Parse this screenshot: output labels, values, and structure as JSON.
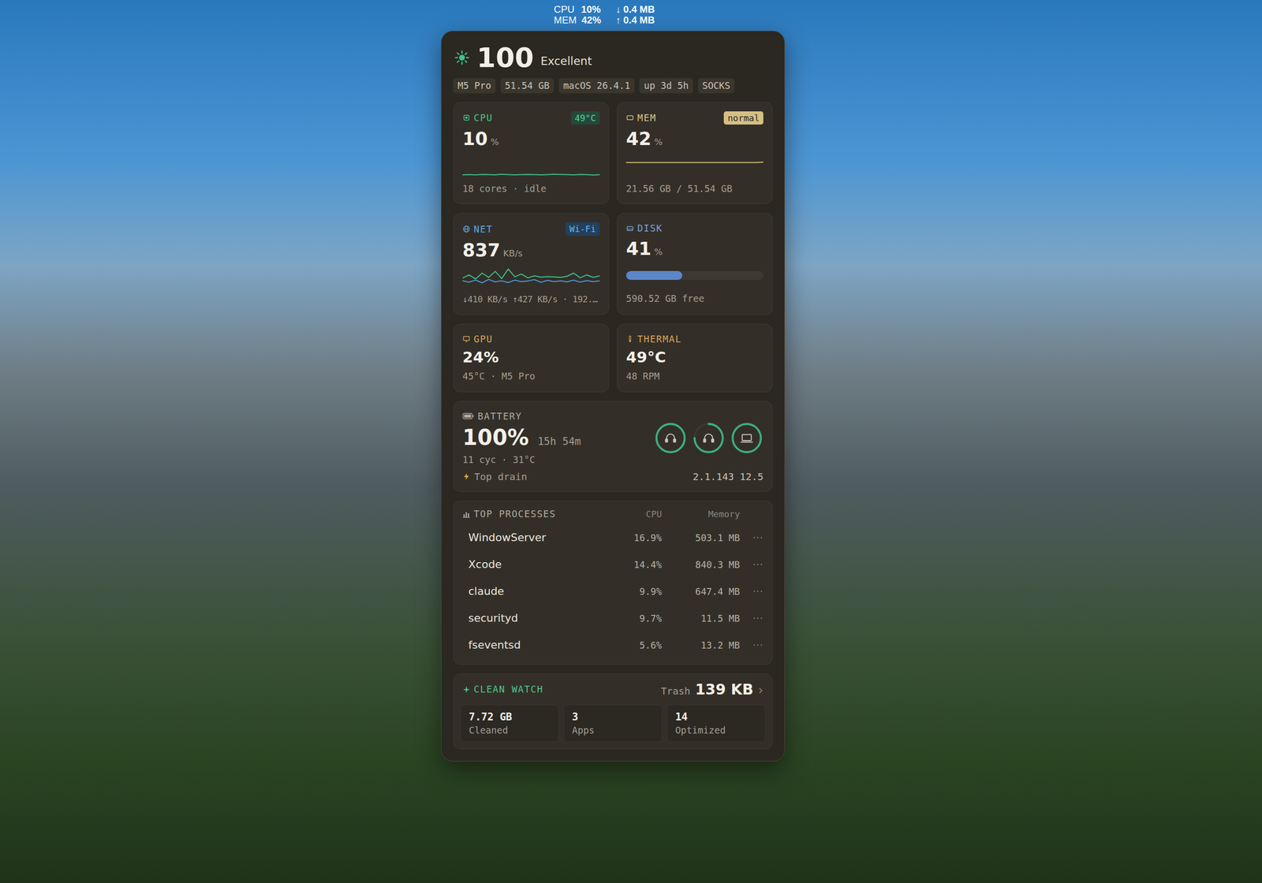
{
  "menubar": {
    "cpu_label": "CPU",
    "cpu_value": "10%",
    "mem_label": "MEM",
    "mem_value": "42%",
    "down": "↓ 0.4 MB",
    "up": "↑ 0.4 MB"
  },
  "health": {
    "score": "100",
    "label": "Excellent"
  },
  "chips": [
    "M5 Pro",
    "51.54 GB",
    "macOS 26.4.1",
    "up 3d 5h",
    "SOCKS"
  ],
  "cpu": {
    "title": "CPU",
    "badge": "49°C",
    "value": "10",
    "unit": "%",
    "detail": "18 cores · idle",
    "series": [
      9,
      10,
      9,
      11,
      10,
      9,
      12,
      10,
      9,
      10,
      11,
      10,
      9,
      10,
      12,
      11,
      10,
      9,
      11,
      10,
      8,
      10
    ]
  },
  "mem": {
    "title": "MEM",
    "badge": "normal",
    "value": "42",
    "unit": "%",
    "detail": "21.56 GB / 51.54 GB",
    "series": [
      42,
      42,
      42,
      42,
      42,
      42,
      42,
      42,
      42,
      42,
      42,
      42,
      42,
      42,
      42,
      42,
      42,
      42,
      42,
      43
    ]
  },
  "net": {
    "title": "NET",
    "badge": "Wi-Fi",
    "value": "837",
    "unit": "KB/s",
    "detail": "↓410 KB/s ↑427 KB/s · 192.…",
    "series_down": [
      420,
      560,
      380,
      640,
      450,
      720,
      400,
      820,
      480,
      600,
      430,
      520,
      460,
      480,
      470,
      450,
      500,
      640,
      430,
      560,
      450,
      520
    ],
    "series_up": [
      300,
      240,
      330,
      210,
      360,
      250,
      300,
      220,
      330,
      260,
      290,
      350,
      230,
      320,
      260,
      300,
      250,
      330,
      240,
      310,
      260,
      300
    ]
  },
  "disk": {
    "title": "DISK",
    "value": "41",
    "unit": "%",
    "level": 0.41,
    "detail": "590.52 GB free"
  },
  "gpu": {
    "title": "GPU",
    "value": "24%",
    "detail": "45°C · M5 Pro"
  },
  "thermal": {
    "title": "THERMAL",
    "value": "49°C",
    "detail": "48 RPM"
  },
  "battery": {
    "title": "BATTERY",
    "value": "100%",
    "remaining": "15h 54m",
    "detail": "11 cyc · 31°C",
    "drain_label": "Top drain",
    "drain_value": "2.1.143 12.5",
    "devices": [
      {
        "kind": "headphones",
        "level": 1.0
      },
      {
        "kind": "headphones",
        "level": 0.75
      },
      {
        "kind": "laptop",
        "level": 1.0
      }
    ]
  },
  "processes": {
    "title": "TOP PROCESSES",
    "columns": [
      "CPU",
      "Memory"
    ],
    "more": "···",
    "rows": [
      {
        "name": "WindowServer",
        "cpu": "16.9%",
        "mem": "503.1 MB"
      },
      {
        "name": "Xcode",
        "cpu": "14.4%",
        "mem": "840.3 MB"
      },
      {
        "name": "claude",
        "cpu": "9.9%",
        "mem": "647.4 MB"
      },
      {
        "name": "securityd",
        "cpu": "9.7%",
        "mem": "11.5 MB"
      },
      {
        "name": "fseventsd",
        "cpu": "5.6%",
        "mem": "13.2 MB"
      }
    ]
  },
  "clean": {
    "title": "CLEAN WATCH",
    "trash_label": "Trash",
    "trash_value": "139 KB",
    "chevron": "›",
    "stats": [
      {
        "value": "7.72 GB",
        "label": "Cleaned"
      },
      {
        "value": "3",
        "label": "Apps"
      },
      {
        "value": "14",
        "label": "Optimized"
      }
    ]
  }
}
